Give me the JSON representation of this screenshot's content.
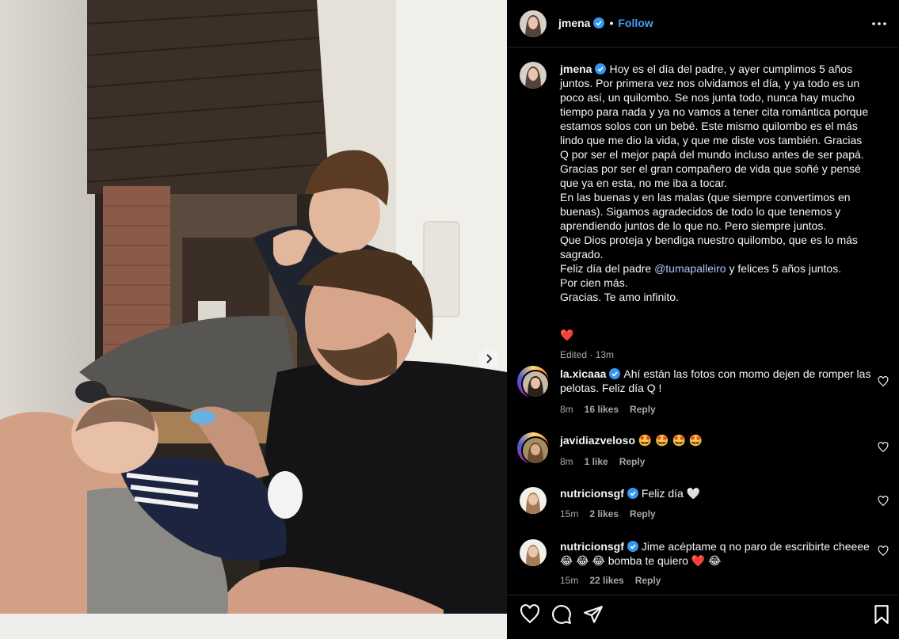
{
  "post": {
    "username": "jmena",
    "follow_label": "Follow",
    "separator": "•"
  },
  "caption": {
    "username": "jmena",
    "text": "Hoy es el día del padre, y ayer cumplimos 5 años juntos. Por primera vez nos olvidamos el día, y ya todo es un poco así, un quilombo. Se nos junta todo, nunca hay mucho tiempo para nada y ya no vamos a tener cita romántica porque estamos solos con un bebé. Este mismo quilombo es el más lindo que me dio la vida, y que me diste vos también. Gracias Q por ser el mejor papá del mundo incluso antes de ser papá. Gracias por ser el gran compañero de vida que soñé y pensé que ya en esta, no me iba a tocar.\nEn las buenas y en las malas (que siempre convertimos en buenas). Sigamos agradecidos de todo lo que tenemos y aprendiendo juntos de lo que no. Pero siempre juntos.\nQue Dios proteja y bendiga nuestro quilombo, que es lo más sagrado.\nFeliz día del padre ",
    "mention": "@tumapalleiro",
    "text_after_mention": " y felices 5 años juntos.\nPor cien más.\nGracias. Te amo infinito.",
    "heart": "❤️",
    "meta": "Edited · 13m"
  },
  "comments": [
    {
      "username": "la.xicaaa",
      "verified": true,
      "text": "Ahí están las fotos con momo dejen de romper las pelotas. Feliz día Q !",
      "time": "8m",
      "likes": "16 likes",
      "reply": "Reply",
      "ring": true
    },
    {
      "username": "javidiazveloso",
      "verified": false,
      "text": "🤩 🤩 🤩 🤩",
      "time": "8m",
      "likes": "1 like",
      "reply": "Reply",
      "ring": true
    },
    {
      "username": "nutricionsgf",
      "verified": true,
      "text": "Feliz día 🤍",
      "time": "15m",
      "likes": "2 likes",
      "reply": "Reply",
      "ring": false
    },
    {
      "username": "nutricionsgf",
      "verified": true,
      "text": "Jime acéptame q no paro de escribirte cheeee 😂 😂 😂 bomba te quiero ❤️ 😂",
      "time": "15m",
      "likes": "22 likes",
      "reply": "Reply",
      "ring": false
    }
  ],
  "icons": {
    "header_more": "more-horizontal-icon",
    "verified": "verified-badge-icon",
    "comment_like": "heart-outline-icon",
    "action_like": "heart-outline-icon",
    "action_comment": "comment-icon",
    "action_share": "send-icon",
    "action_save": "bookmark-icon",
    "carousel_next": "chevron-right-icon"
  },
  "colors": {
    "background": "#000000",
    "text": "#f5f5f5",
    "secondary_text": "#a8a8a8",
    "link": "#4a9bf6",
    "verified": "#3797f0",
    "like_red": "#ff3040"
  }
}
